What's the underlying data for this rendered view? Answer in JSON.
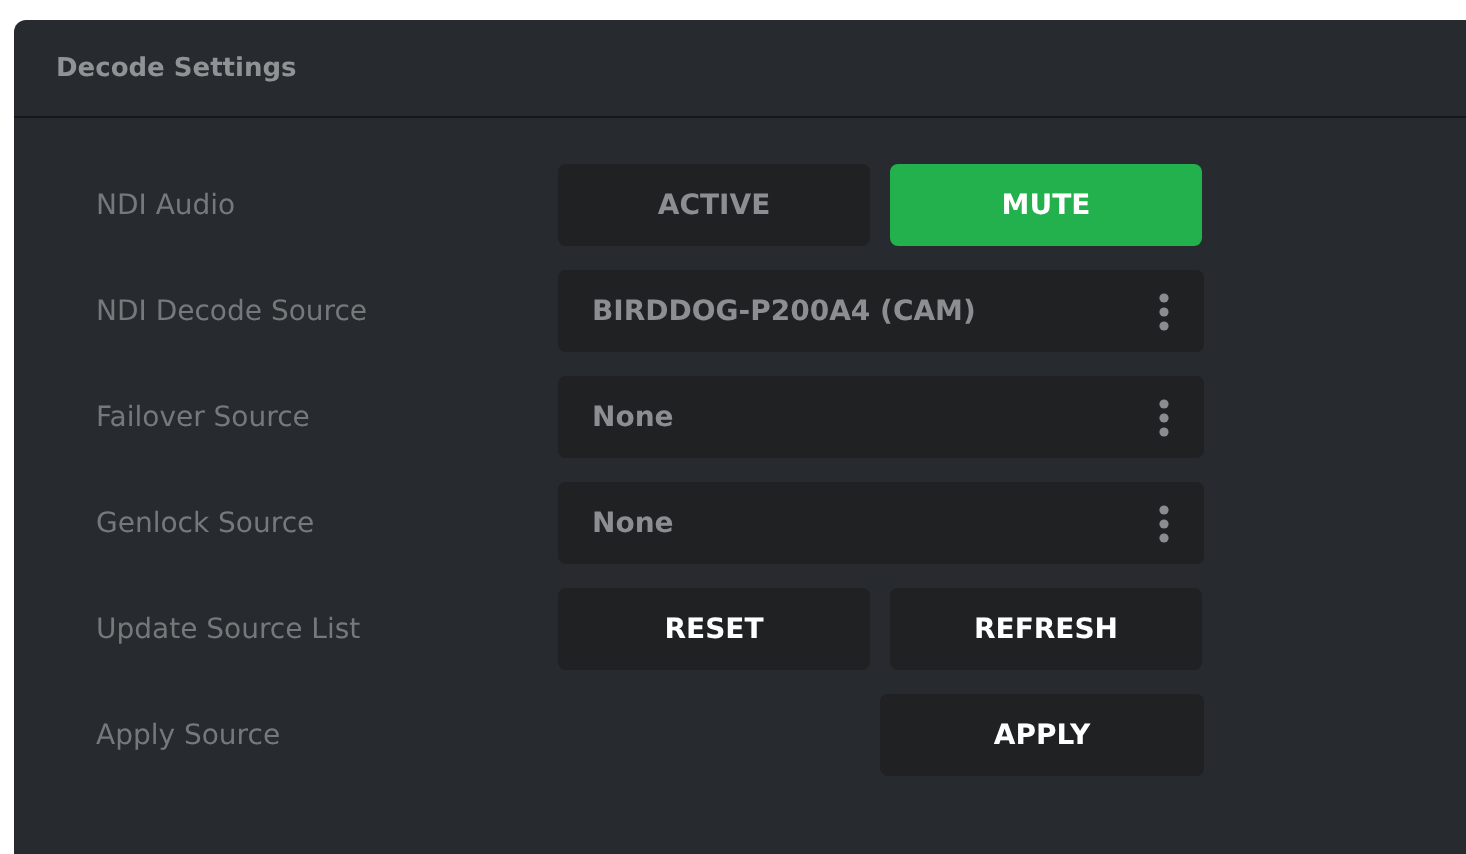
{
  "panel": {
    "title": "Decode Settings"
  },
  "rows": [
    {
      "kind": "toggle",
      "label": "NDI Audio",
      "options": [
        {
          "label": "ACTIVE",
          "selected": false
        },
        {
          "label": "MUTE",
          "selected": true
        }
      ]
    },
    {
      "kind": "select",
      "label": "NDI Decode Source",
      "value": "BIRDDOG-P200A4 (CAM)"
    },
    {
      "kind": "select",
      "label": "Failover Source",
      "value": "None"
    },
    {
      "kind": "select",
      "label": "Genlock Source",
      "value": "None"
    },
    {
      "kind": "buttons",
      "label": "Update Source List",
      "buttons": [
        "RESET",
        "REFRESH"
      ]
    },
    {
      "kind": "apply",
      "label": "Apply Source",
      "buttons": [
        "APPLY"
      ]
    }
  ]
}
